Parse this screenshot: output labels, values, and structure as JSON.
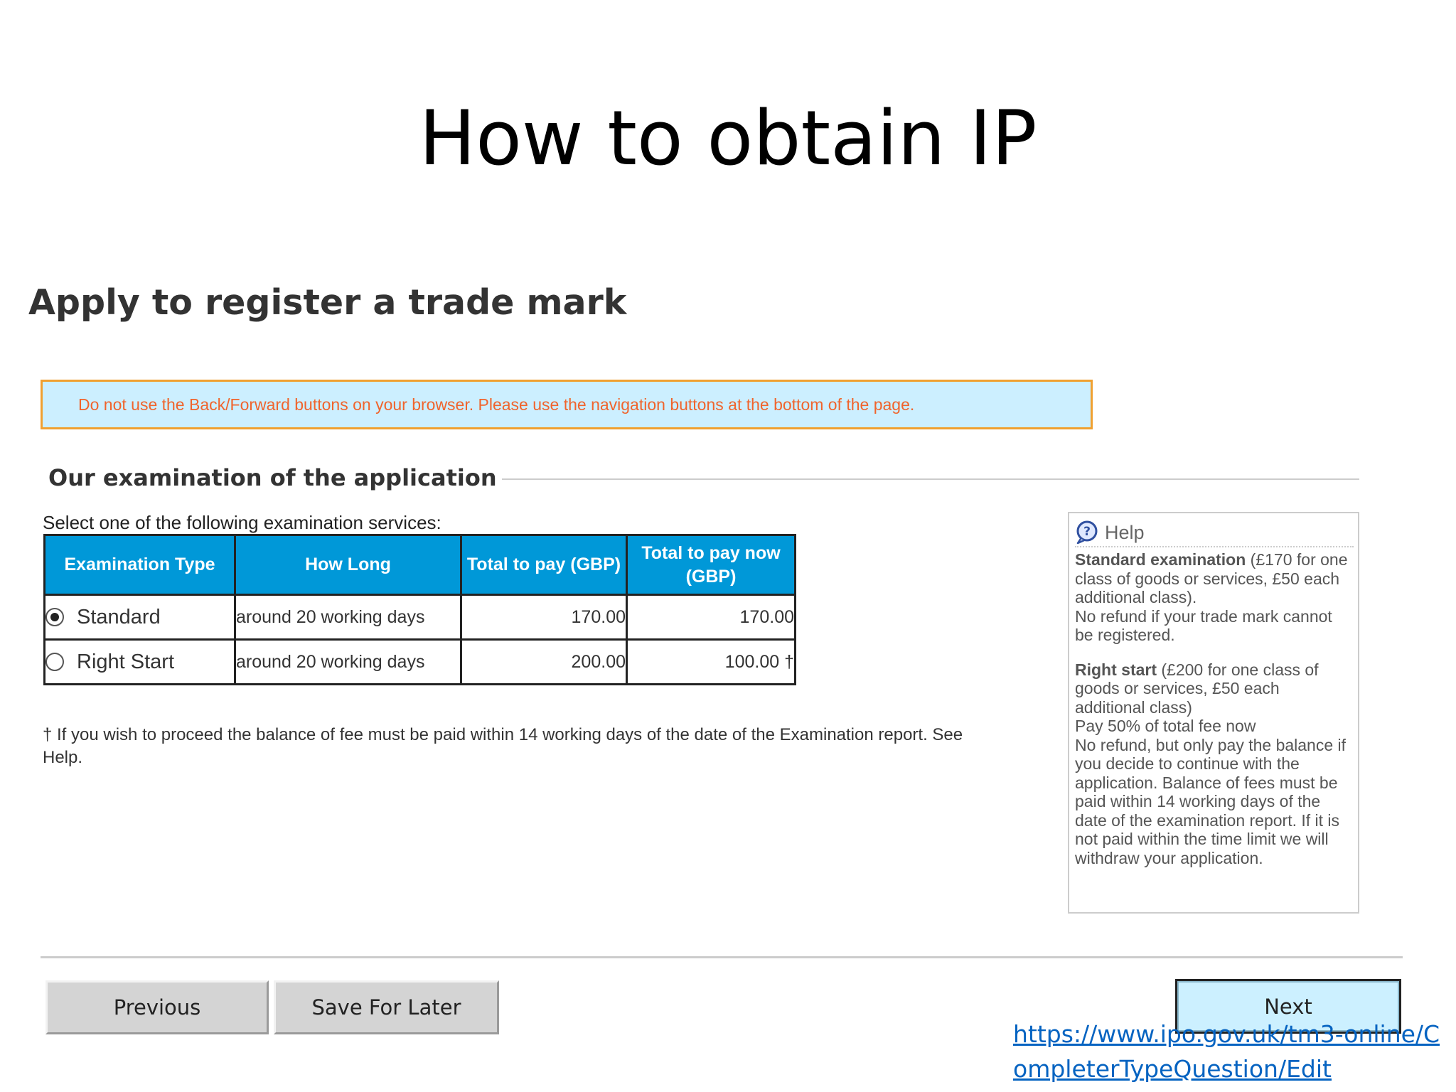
{
  "slide": {
    "title": "How to obtain IP"
  },
  "app": {
    "heading": "Apply to register a trade mark",
    "nav_warning": "Do not use the Back/Forward buttons on your browser. Please use the navigation buttons at the bottom of the page."
  },
  "examination": {
    "section_title": "Our examination of the application",
    "prompt": "Select one of the following examination services:",
    "columns": [
      "Examination Type",
      "How Long",
      "Total to pay (GBP)",
      "Total to pay now (GBP)"
    ],
    "rows": [
      {
        "type": "Standard",
        "selected": true,
        "how_long": "around 20 working days",
        "total": "170.00",
        "total_now": "170.00"
      },
      {
        "type": "Right Start",
        "selected": false,
        "how_long": "around 20 working days",
        "total": "200.00",
        "total_now": "100.00 †"
      }
    ],
    "footnote": "† If you wish to proceed the balance of fee must be paid within 14 working days of the date of the Examination report. See Help."
  },
  "help": {
    "title": "Help",
    "standard_name": "Standard examination",
    "standard_detail": "(£170 for one class of goods or services, £50 each additional class).",
    "standard_note": "No refund if your trade mark cannot be registered.",
    "right_start_name": "Right start",
    "right_start_detail": "(£200 for one class of goods or services, £50 each additional class)",
    "right_start_pay": "Pay 50% of total fee now",
    "right_start_note": "No refund, but only pay the balance if you decide to continue with the application. Balance of fees must be paid within 14 working days of the date of the examination report. If it is not paid within the time limit we will withdraw your application."
  },
  "buttons": {
    "previous": "Previous",
    "save": "Save For Later",
    "next": "Next"
  },
  "source": {
    "url_text": "https://www.ipo.gov.uk/tm3-online/CompleterTypeQuestion/Edit"
  },
  "colors": {
    "table_header": "#0098d8",
    "warning_bg": "#ccefff",
    "warning_border": "#f0a030",
    "warning_text": "#f0642c",
    "next_button_bg": "#ccf0ff",
    "link": "#0563c1"
  }
}
